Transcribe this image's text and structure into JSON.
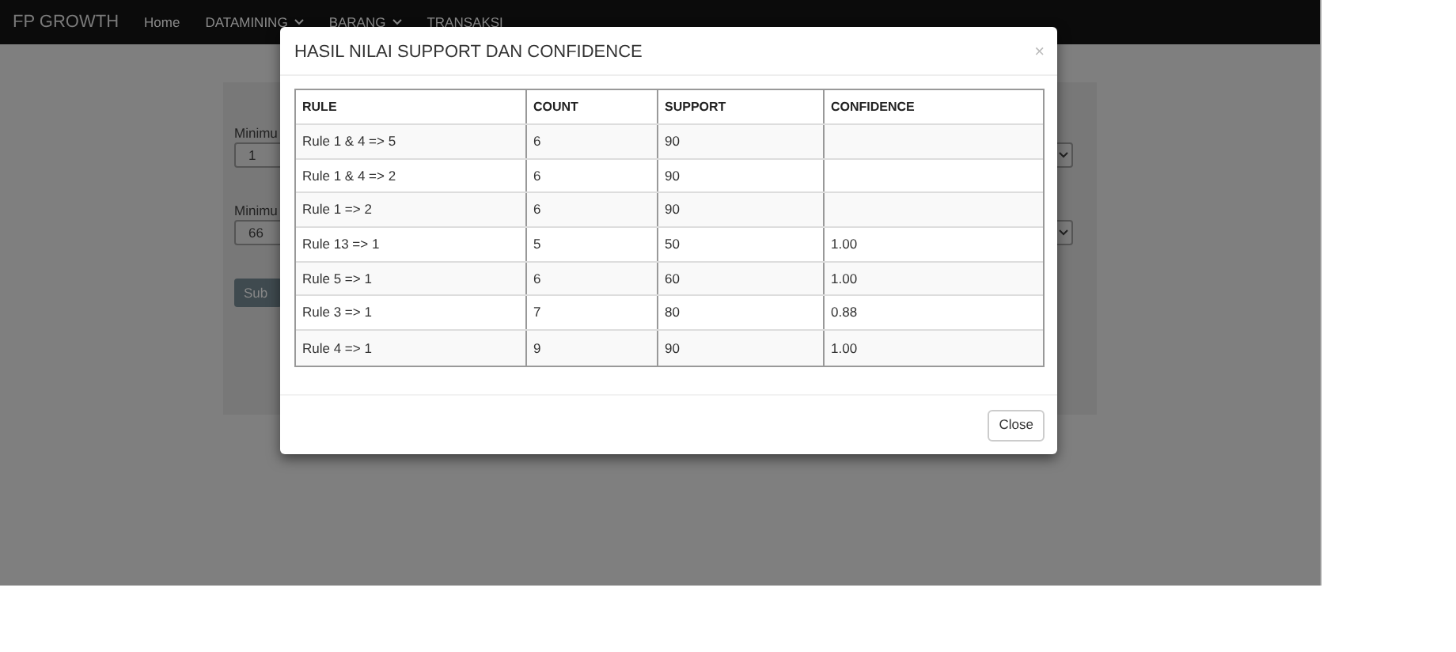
{
  "navbar": {
    "brand": "FP GROWTH",
    "items": [
      {
        "label": "Home",
        "dropdown": false
      },
      {
        "label": "DATAMINING",
        "dropdown": true
      },
      {
        "label": "BARANG",
        "dropdown": true
      },
      {
        "label": "TRANSAKSI",
        "dropdown": false
      }
    ]
  },
  "form": {
    "fields": [
      {
        "label": "Minimu",
        "value": "1"
      },
      {
        "label": "Minimu",
        "value": "66"
      }
    ],
    "submit": "Sub"
  },
  "modal": {
    "title": "HASIL NILAI SUPPORT DAN CONFIDENCE",
    "close_symbol": "×",
    "columns": [
      "RULE",
      "COUNT",
      "SUPPORT",
      "CONFIDENCE"
    ],
    "rows": [
      {
        "rule": "Rule 1 & 4 => 5",
        "count": "6",
        "support": "90"
      },
      {
        "rule": "Rule 1 & 4 => 2",
        "count": "6",
        "support": "90"
      },
      {
        "rule": "Rule 1 => 2",
        "count": "6",
        "support": "90"
      },
      {
        "rule": "Rule 13 => 1",
        "count": "5",
        "support": "50",
        "confidence": "1.00"
      },
      {
        "rule": "Rule 5 => 1",
        "count": "6",
        "support": "60",
        "confidence": "1.00"
      },
      {
        "rule": "Rule 3 => 1",
        "count": "7",
        "support": "80",
        "confidence": "0.88"
      },
      {
        "rule": "Rule 4 => 1",
        "count": "9",
        "support": "90",
        "confidence": "1.00"
      }
    ],
    "button": "Close"
  }
}
